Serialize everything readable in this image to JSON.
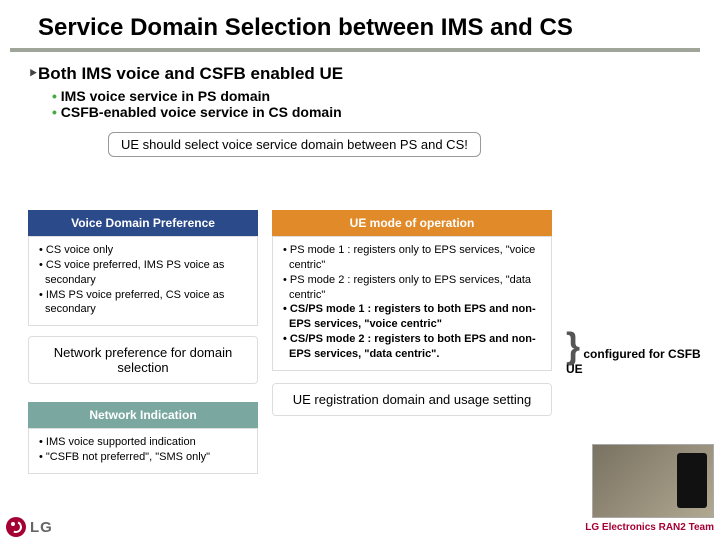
{
  "title": "Service Domain Selection between IMS and CS",
  "headline": "Both IMS voice and CSFB  enabled UE",
  "sub_bullets": {
    "a": "IMS voice service in PS domain",
    "b": "CSFB-enabled voice service in CS domain"
  },
  "callout": "UE should select voice service domain between PS and CS!",
  "vdp": {
    "title": "Voice Domain Preference",
    "items": {
      "a": "• CS voice only",
      "b": "• CS voice preferred, IMS PS voice as secondary",
      "c": "• IMS PS voice preferred, CS voice as secondary"
    }
  },
  "ue_mode": {
    "title": "UE mode of operation",
    "items": {
      "a": "• PS mode 1 : registers only to EPS services, \"voice centric\"",
      "b": "• PS mode 2 : registers only to EPS services, \"data centric\"",
      "c": "• CS/PS mode 1 : registers to both EPS and non-EPS services, \"voice centric\"",
      "d": "• CS/PS mode 2 : registers to both EPS and non-EPS services, \"data centric\"."
    }
  },
  "side_note": "configured for CSFB UE",
  "left_big": "Network preference for domain selection",
  "mid_big": "UE registration domain and usage setting",
  "net": {
    "title": "Network Indication",
    "items": {
      "a": "• IMS voice supported indication",
      "b": "• \"CSFB not preferred\", \"SMS only\""
    }
  },
  "logo_text": "LG",
  "footer_team": "LG Electronics RAN2 Team"
}
